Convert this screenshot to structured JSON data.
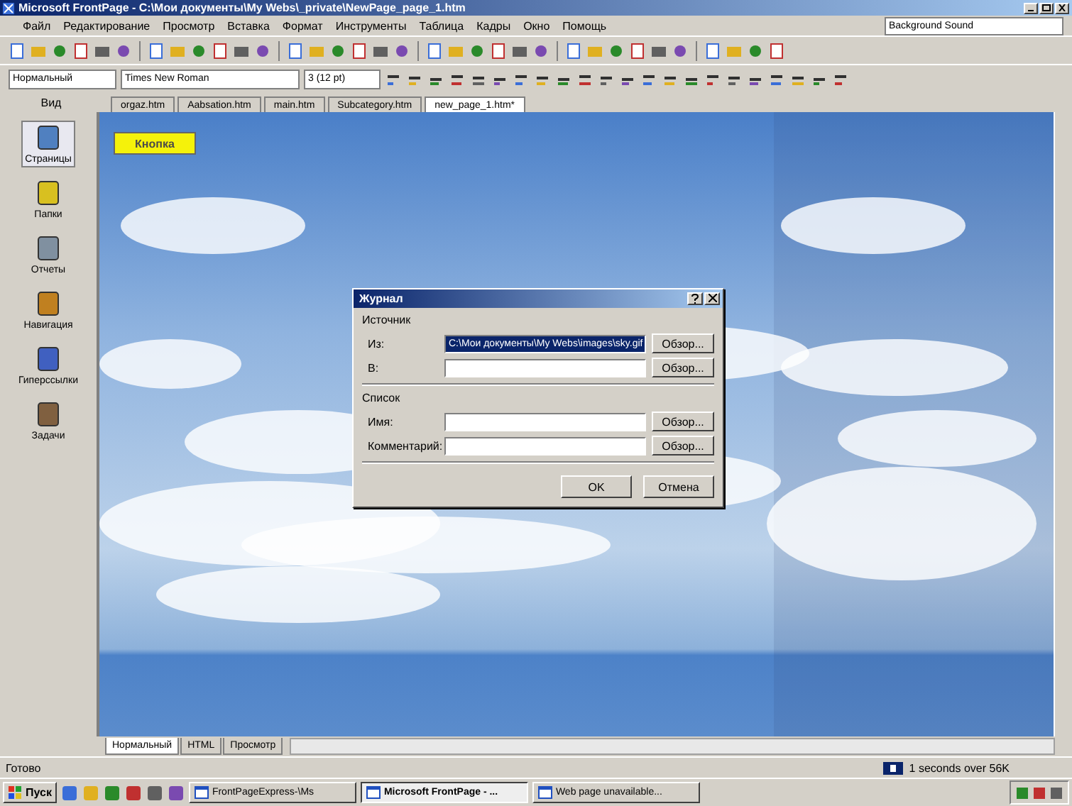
{
  "window": {
    "title": "Microsoft FrontPage - C:\\Мои документы\\My Webs\\_private\\NewPage_page_1.htm"
  },
  "menu": [
    "Файл",
    "Редактирование",
    "Просмотр",
    "Вставка",
    "Формат",
    "Инструменты",
    "Таблица",
    "Кадры",
    "Окно",
    "Помощь"
  ],
  "menu_dropdown": {
    "value": "Background Sound"
  },
  "format_bar": {
    "style": "Нормальный",
    "font": "Times New Roman",
    "size": "3 (12 pt)"
  },
  "views": {
    "title": "Вид",
    "items": [
      {
        "label": "Страницы",
        "selected": true
      },
      {
        "label": "Папки",
        "selected": false
      },
      {
        "label": "Отчеты",
        "selected": false
      },
      {
        "label": "Навигация",
        "selected": false
      },
      {
        "label": "Гиперссылки",
        "selected": false
      },
      {
        "label": "Задачи",
        "selected": false
      }
    ]
  },
  "doc_tabs": [
    {
      "label": "orgaz.htm",
      "selected": false
    },
    {
      "label": "Aabsation.htm",
      "selected": false
    },
    {
      "label": "main.htm",
      "selected": false
    },
    {
      "label": "Subcategory.htm",
      "selected": false
    },
    {
      "label": "new_page_1.htm*",
      "selected": true
    }
  ],
  "page": {
    "hover_button": "Кнопка"
  },
  "dialog": {
    "title": "Журнал",
    "groups": [
      {
        "label": "Источник",
        "fields": [
          {
            "label": "Из:",
            "value": "C:\\Мои документы\\My Webs\\images\\sky.gif",
            "selected": true,
            "button": "Обзор..."
          },
          {
            "label": "В:",
            "selected": false,
            "button": "Обзор..."
          }
        ]
      },
      {
        "label": "Список",
        "fields": [
          {
            "label": "Имя:",
            "selected": false,
            "button": "Обзор..."
          },
          {
            "label": "Комментарий:",
            "selected": false,
            "button": "Обзор..."
          }
        ]
      }
    ],
    "ok": "OK",
    "cancel": "Отмена"
  },
  "view_tabs": [
    {
      "label": "Нормальный",
      "selected": true
    },
    {
      "label": "HTML",
      "selected": false
    },
    {
      "label": "Просмотр",
      "selected": false
    }
  ],
  "status_bar": {
    "text": "Готово",
    "timing": "1 seconds over 56K"
  },
  "taskbar": {
    "start": "Пуск",
    "tasks": [
      {
        "label": "FrontPageExpress-\\Ms",
        "selected": false
      },
      {
        "label": "Microsoft FrontPage - ...",
        "selected": true
      },
      {
        "label": "Web page unavailable...",
        "selected": false
      }
    ]
  }
}
